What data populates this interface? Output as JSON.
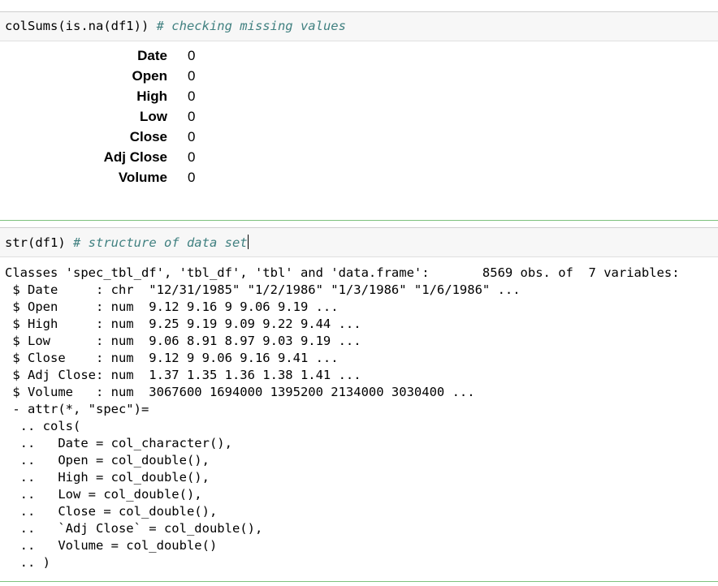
{
  "cell1": {
    "code": "colSums(is.na(df1)) ",
    "comment": "# checking missing values"
  },
  "na_counts": [
    {
      "name": "Date",
      "value": "0"
    },
    {
      "name": "Open",
      "value": "0"
    },
    {
      "name": "High",
      "value": "0"
    },
    {
      "name": "Low",
      "value": "0"
    },
    {
      "name": "Close",
      "value": "0"
    },
    {
      "name": "Adj Close",
      "value": "0"
    },
    {
      "name": "Volume",
      "value": "0"
    }
  ],
  "cell2": {
    "code": "str(df1) ",
    "comment": "# structure of data set"
  },
  "str_output": [
    "Classes 'spec_tbl_df', 'tbl_df', 'tbl' and 'data.frame':       8569 obs. of  7 variables:",
    " $ Date     : chr  \"12/31/1985\" \"1/2/1986\" \"1/3/1986\" \"1/6/1986\" ...",
    " $ Open     : num  9.12 9.16 9 9.06 9.19 ...",
    " $ High     : num  9.25 9.19 9.09 9.22 9.44 ...",
    " $ Low      : num  9.06 8.91 8.97 9.03 9.19 ...",
    " $ Close    : num  9.12 9 9.06 9.16 9.41 ...",
    " $ Adj Close: num  1.37 1.35 1.36 1.38 1.41 ...",
    " $ Volume   : num  3067600 1694000 1395200 2134000 3030400 ...",
    " - attr(*, \"spec\")=",
    "  .. cols(",
    "  ..   Date = col_character(),",
    "  ..   Open = col_double(),",
    "  ..   High = col_double(),",
    "  ..   Low = col_double(),",
    "  ..   Close = col_double(),",
    "  ..   `Adj Close` = col_double(),",
    "  ..   Volume = col_double()",
    "  .. )"
  ]
}
